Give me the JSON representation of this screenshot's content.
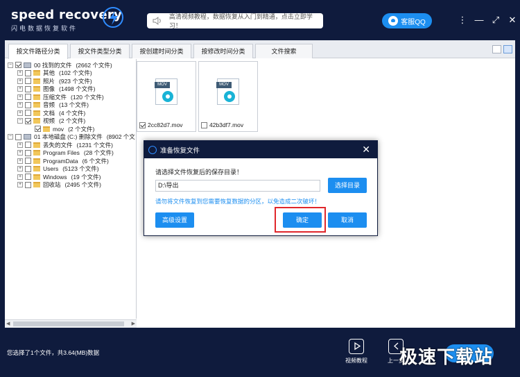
{
  "app": {
    "logo_main": "speed recovery",
    "logo_sub": "闪电数据恢复软件",
    "notice": "高清视频教程，数据恢复从入门到精通，点击立即学习！",
    "qq_label": "客服QQ",
    "accent": "#1c8ef0",
    "bg": "#0f1b3d"
  },
  "window_controls": [
    "⋮",
    "—",
    "⤢",
    "✕"
  ],
  "tabs": [
    {
      "label": "按文件路径分类",
      "active": true
    },
    {
      "label": "按文件类型分类",
      "active": false
    },
    {
      "label": "按创建时间分类",
      "active": false
    },
    {
      "label": "按修改时间分类",
      "active": false
    },
    {
      "label": "文件搜索",
      "active": false
    }
  ],
  "tree": [
    {
      "label": "00 找到的文件",
      "count": "(2662 个文件)"
    },
    {
      "label": "其他",
      "count": "(102 个文件)"
    },
    {
      "label": "照片",
      "count": "(923 个文件)"
    },
    {
      "label": "图像",
      "count": "(1498 个文件)"
    },
    {
      "label": "压缩文件",
      "count": "(120 个文件)"
    },
    {
      "label": "音频",
      "count": "(13 个文件)"
    },
    {
      "label": "文档",
      "count": "(4 个文件)"
    },
    {
      "label": "视频",
      "count": "(2 个文件)"
    },
    {
      "label": "mov",
      "count": "(2 个文件)"
    },
    {
      "label": "01 本地磁盘 (C:) 删除文件",
      "count": "(8902 个文"
    },
    {
      "label": "丢失的文件",
      "count": "(1231 个文件)"
    },
    {
      "label": "Program Files",
      "count": "(28 个文件)"
    },
    {
      "label": "ProgramData",
      "count": "(6 个文件)"
    },
    {
      "label": "Users",
      "count": "(5123 个文件)"
    },
    {
      "label": "Windows",
      "count": "(19 个文件)"
    },
    {
      "label": "回收站",
      "count": "(2495 个文件)"
    }
  ],
  "files": [
    {
      "name": "2cc82d7.mov",
      "type": "MOV",
      "checked": true
    },
    {
      "name": "42b3df7.mov",
      "type": "MOV",
      "checked": false
    }
  ],
  "status": {
    "text": "您选择了1个文件，共3.64(MB)数据",
    "video_tutorial": "视频教程",
    "prev_step": "上一步"
  },
  "watermark": "极速下载站",
  "dialog": {
    "title": "准备恢复文件",
    "prompt": "请选择文件恢复后的保存目录！",
    "path": "D:\\导出",
    "browse_label": "选择目录",
    "warning": "请勿将文件恢复到您需要恢复数据的分区，以免造成二次破坏！",
    "advanced_label": "高级设置",
    "ok_label": "确定",
    "cancel_label": "取消"
  }
}
